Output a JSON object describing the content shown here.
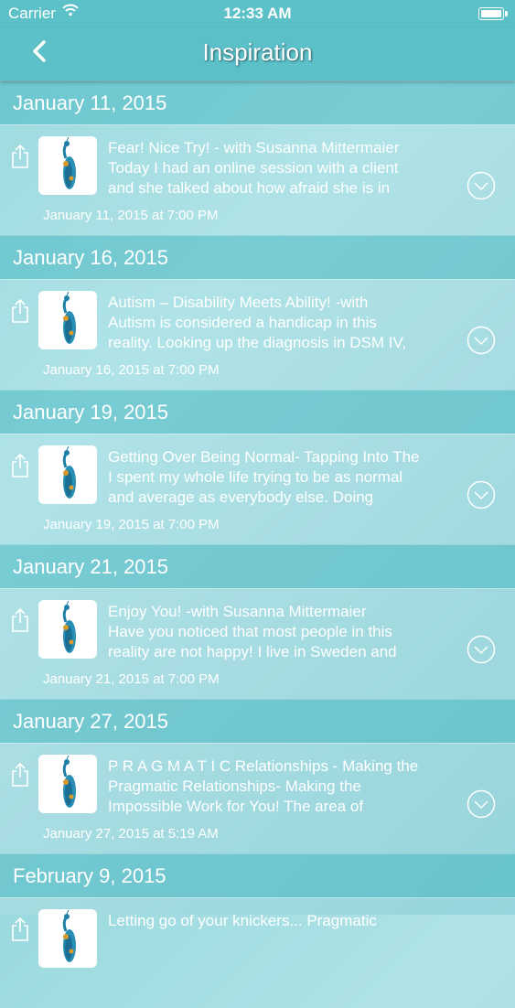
{
  "status_bar": {
    "carrier": "Carrier",
    "time": "12:33 AM"
  },
  "nav": {
    "title": "Inspiration"
  },
  "sections": [
    {
      "header": "January 11, 2015",
      "item": {
        "line1": "Fear! Nice Try! - with Susanna Mittermaier",
        "line2": "Today I had an online session with a client",
        "line3": "and she talked about how afraid she is in",
        "date": "January 11, 2015 at 7:00 PM"
      }
    },
    {
      "header": "January 16, 2015",
      "item": {
        "line1": "Autism – Disability Meets Ability! -with",
        "line2": "Autism is considered a handicap in this",
        "line3": "reality.   Looking up the diagnosis in DSM IV,",
        "date": "January 16, 2015 at 7:00 PM"
      }
    },
    {
      "header": "January 19, 2015",
      "item": {
        "line1": "Getting Over Being Normal- Tapping Into The",
        "line2": "  I spent my whole life trying to be as normal",
        "line3": "and average as everybody else. Doing",
        "date": "January 19, 2015 at 7:00 PM"
      }
    },
    {
      "header": "January 21, 2015",
      "item": {
        "line1": "Enjoy You!  -with Susanna Mittermaier",
        "line2": "  Have you noticed that most people in this",
        "line3": "reality are not happy!   I live in Sweden and",
        "date": "January 21, 2015 at 7:00 PM"
      }
    },
    {
      "header": "January 27, 2015",
      "item": {
        "line1": "P R A G M A T I C Relationships - Making the",
        "line2": "  Pragmatic Relationships- Making the",
        "line3": "Impossible Work for You!   The area of",
        "date": "January 27, 2015 at 5:19 AM"
      }
    },
    {
      "header": "February 9, 2015",
      "item": {
        "line1": "Letting go of your knickers... Pragmatic",
        "line2": "",
        "line3": "",
        "date": ""
      }
    }
  ],
  "colors": {
    "bar": "#5cc0c9",
    "text": "#ffffff",
    "peacock": "#1f7fa6"
  },
  "icons": {
    "back": "chevron-left-icon",
    "share": "share-icon",
    "expand": "chevron-down-circle-icon",
    "thumb": "peacock-thumbnail"
  }
}
